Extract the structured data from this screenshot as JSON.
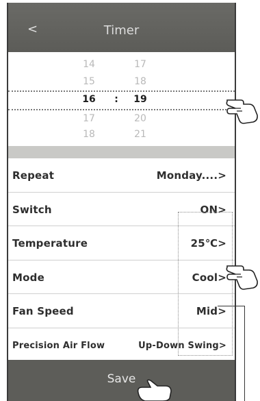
{
  "header": {
    "back_label": "<",
    "title": "Timer"
  },
  "picker": {
    "rows": [
      {
        "hour": "14",
        "minute": "17"
      },
      {
        "hour": "15",
        "minute": "18"
      },
      {
        "hour": "16",
        "minute": "19"
      },
      {
        "hour": "17",
        "minute": "20"
      },
      {
        "hour": "18",
        "minute": "21"
      }
    ],
    "separator": ":"
  },
  "settings": [
    {
      "label": "Repeat",
      "value": "Monday....>"
    },
    {
      "label": "Switch",
      "value": "ON>"
    },
    {
      "label": "Temperature",
      "value": "25℃>"
    },
    {
      "label": "Mode",
      "value": "Cool>"
    },
    {
      "label": "Fan Speed",
      "value": "Mid>"
    },
    {
      "label": "Precision Air Flow",
      "value": "Up-Down Swing>"
    }
  ],
  "save_label": "Save",
  "colors": {
    "header_bg": "#5c5c58",
    "save_bg": "#5d5d59",
    "separator_bg": "#c9c9c6"
  },
  "icons": [
    "pointing-hand-icon"
  ]
}
